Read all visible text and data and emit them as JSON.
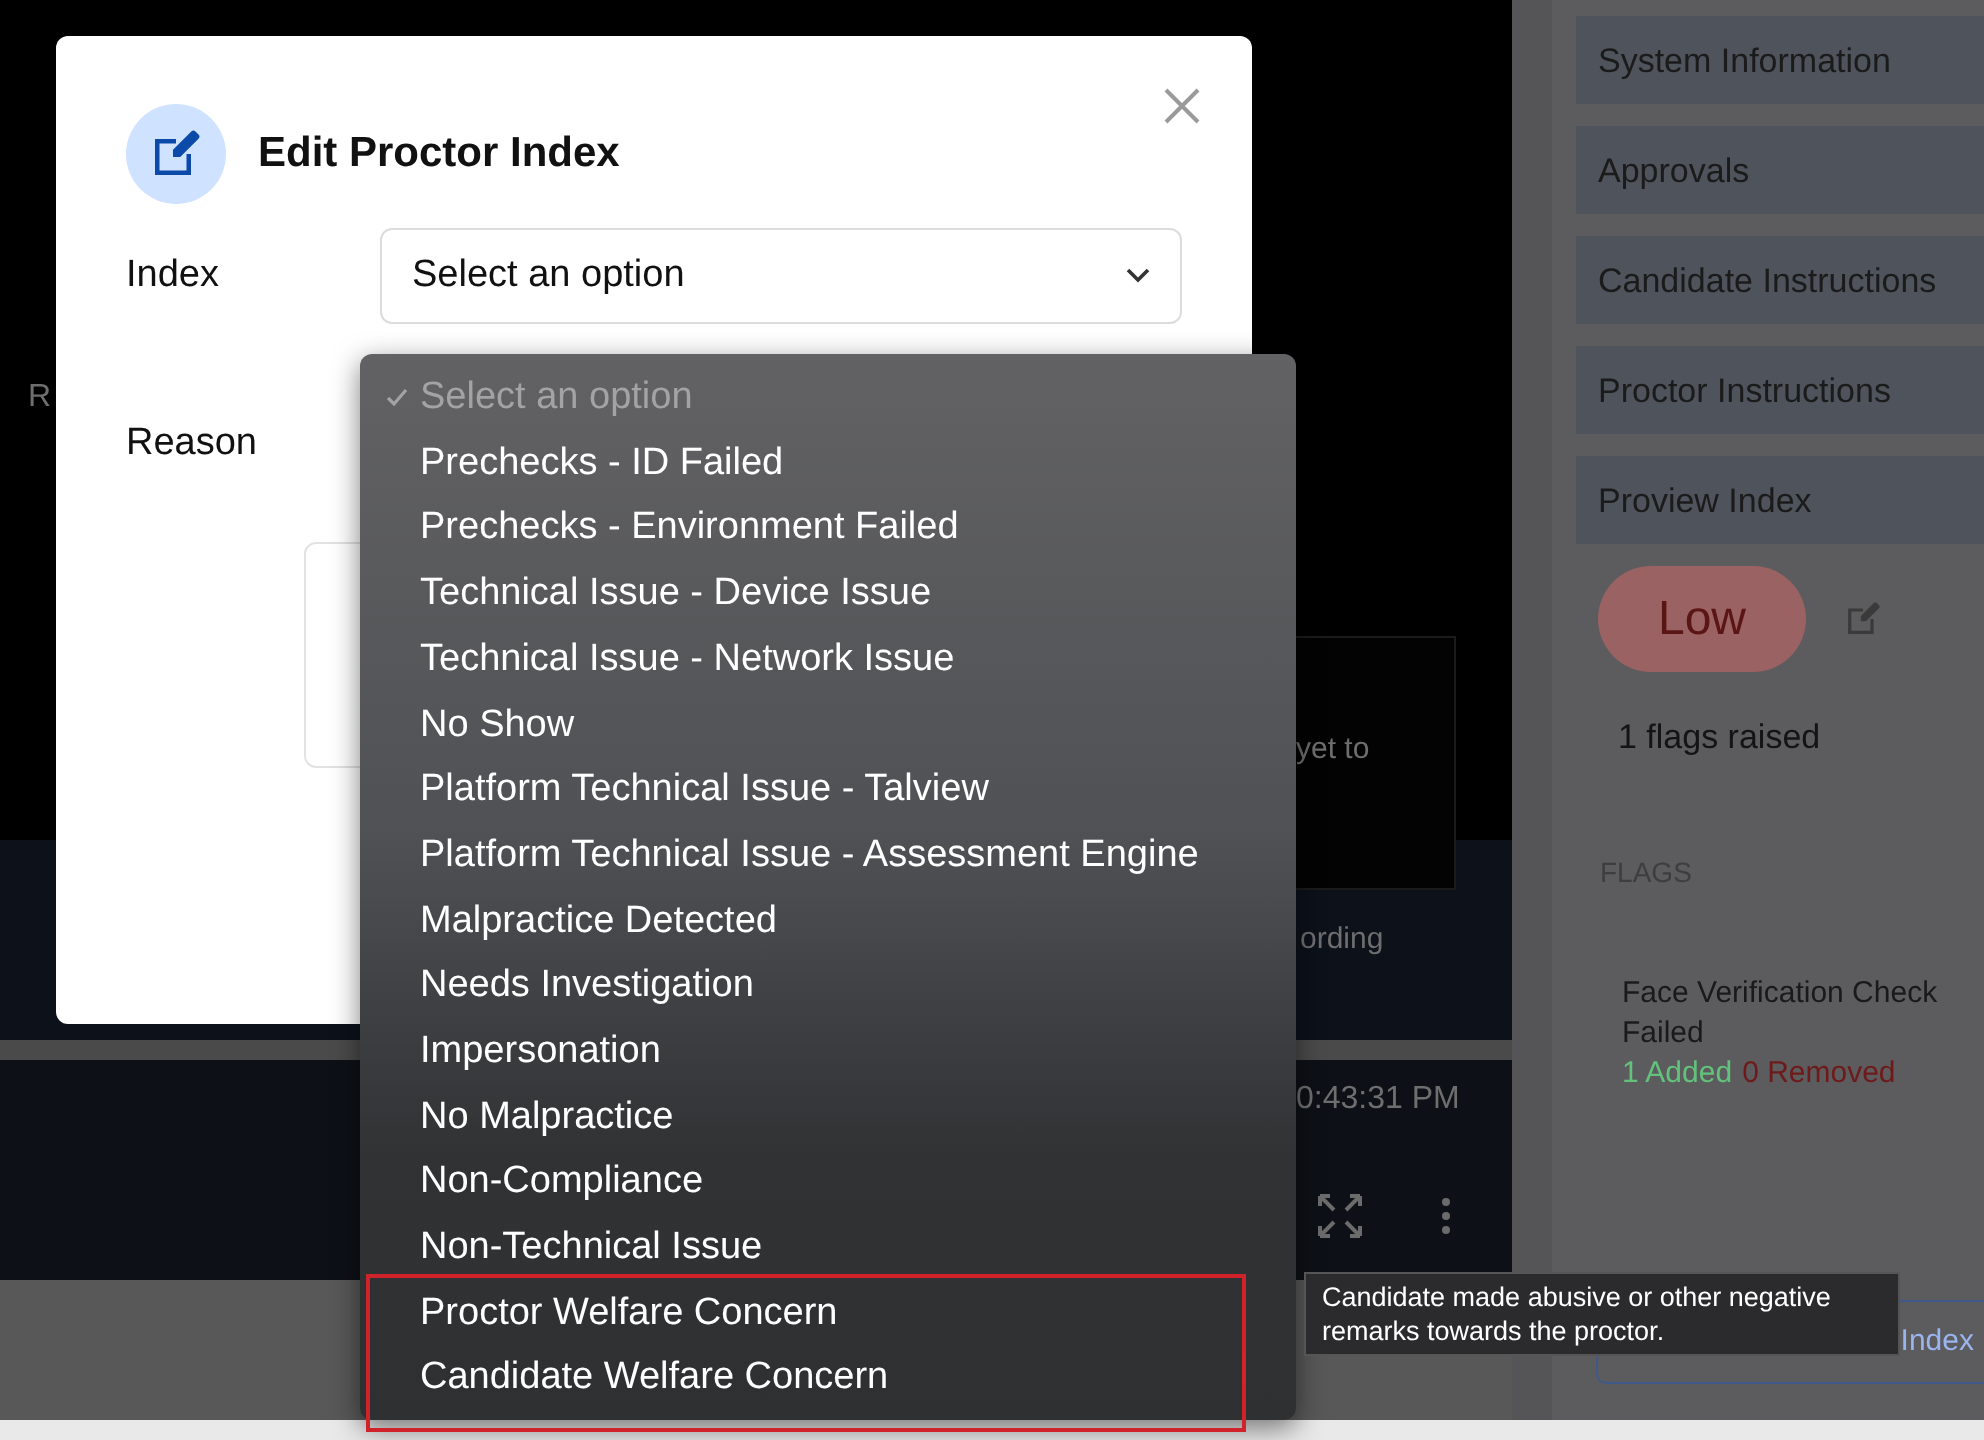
{
  "video_panel": {
    "cut_label": "R",
    "message": "yet to",
    "recording_label": "ording",
    "time": "0:43:31 PM"
  },
  "sidebar": {
    "sections": [
      "System Information",
      "Approvals",
      "Candidate Instructions",
      "Proctor Instructions",
      "Proview Index"
    ],
    "index_badge": "Low",
    "flags_count": "1 flags raised",
    "flags_heading": "FLAGS",
    "flags": [
      {
        "title": "Face Verification Check Failed",
        "added": "1 Added",
        "removed": "0 Removed"
      }
    ],
    "button": "Index"
  },
  "modal": {
    "title": "Edit Proctor Index",
    "fields": [
      {
        "kind": "select",
        "label": "Index",
        "placeholder": "Select an option"
      },
      {
        "kind": "textarea",
        "label": "Reason"
      }
    ]
  },
  "dropdown": {
    "options": [
      {
        "label": "Select an option",
        "selected": true,
        "disabled": true,
        "highlighted": false
      },
      {
        "label": "Prechecks - ID Failed",
        "selected": false,
        "disabled": false,
        "highlighted": false
      },
      {
        "label": "Prechecks - Environment Failed",
        "selected": false,
        "disabled": false,
        "highlighted": false
      },
      {
        "label": "Technical Issue - Device Issue",
        "selected": false,
        "disabled": false,
        "highlighted": false
      },
      {
        "label": "Technical Issue - Network Issue",
        "selected": false,
        "disabled": false,
        "highlighted": false
      },
      {
        "label": "No Show",
        "selected": false,
        "disabled": false,
        "highlighted": false
      },
      {
        "label": "Platform Technical Issue - Talview",
        "selected": false,
        "disabled": false,
        "highlighted": false
      },
      {
        "label": "Platform Technical Issue - Assessment Engine",
        "selected": false,
        "disabled": false,
        "highlighted": false
      },
      {
        "label": "Malpractice Detected",
        "selected": false,
        "disabled": false,
        "highlighted": false
      },
      {
        "label": "Needs Investigation",
        "selected": false,
        "disabled": false,
        "highlighted": false
      },
      {
        "label": "Impersonation",
        "selected": false,
        "disabled": false,
        "highlighted": false
      },
      {
        "label": "No Malpractice",
        "selected": false,
        "disabled": false,
        "highlighted": false
      },
      {
        "label": "Non-Compliance",
        "selected": false,
        "disabled": false,
        "highlighted": false
      },
      {
        "label": "Non-Technical Issue",
        "selected": false,
        "disabled": false,
        "highlighted": false
      },
      {
        "label": "Proctor Welfare Concern",
        "selected": false,
        "disabled": false,
        "highlighted": true
      },
      {
        "label": "Candidate Welfare Concern",
        "selected": false,
        "disabled": false,
        "highlighted": true
      }
    ]
  },
  "tooltip": "Candidate made abusive or other negative remarks towards the proctor."
}
